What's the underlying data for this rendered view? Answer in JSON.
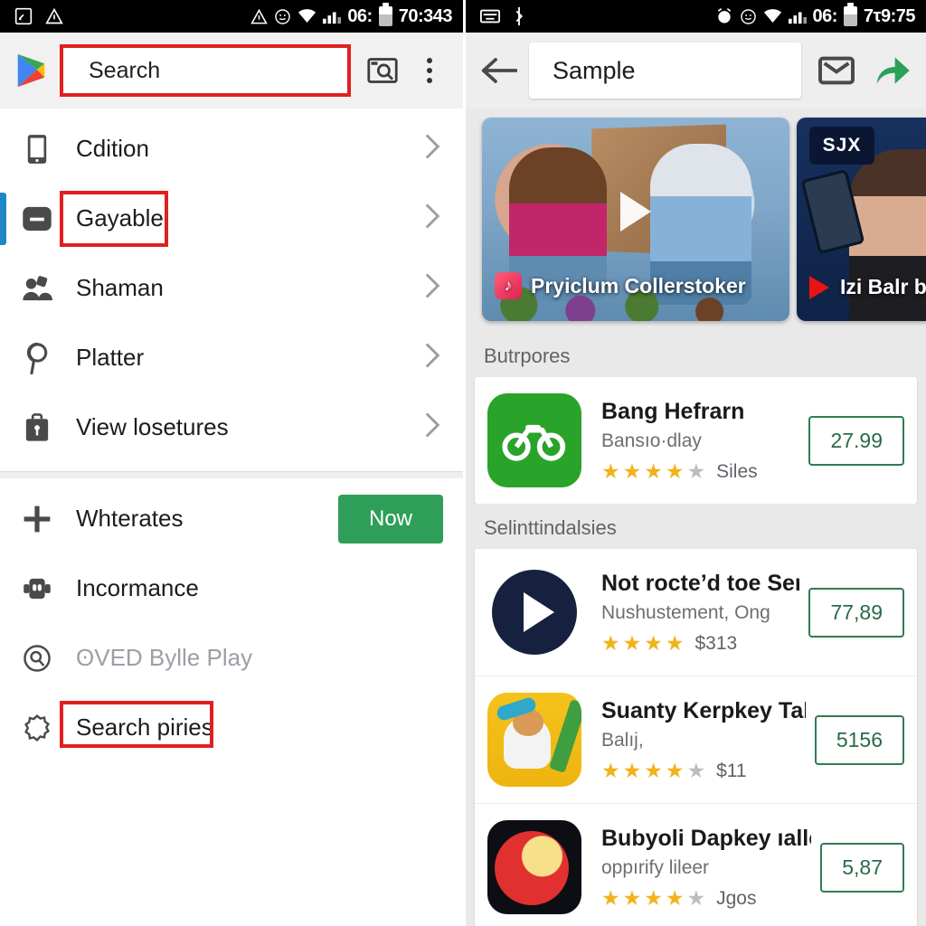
{
  "left": {
    "statusbar": {
      "icons": [
        "screenshot-icon",
        "warning-triangle-icon"
      ],
      "right_icons": [
        "warning-icon",
        "emoji-icon",
        "wifi-icon",
        "signal-icon"
      ],
      "clock": "06:",
      "extra": "70:343"
    },
    "toolbar": {
      "logo": "google-play-logo",
      "search_value": "Search",
      "voice_icon": "image-search-icon",
      "overflow_icon": "more-vertical-icon"
    },
    "menu_primary": [
      {
        "icon": "phone-icon",
        "label": "Cdition",
        "chevron": "›"
      },
      {
        "icon": "minus-box-icon",
        "label": "Gayable",
        "chevron": "›",
        "highlighted": true,
        "accent": true
      },
      {
        "icon": "people-icon",
        "label": "Shaman",
        "chevron": "›"
      },
      {
        "icon": "pinterest-p-icon",
        "label": "Platter",
        "chevron": "›"
      },
      {
        "icon": "briefcase-lock-icon",
        "label": "View losetures",
        "chevron": "›"
      }
    ],
    "menu_secondary": [
      {
        "icon": "plus-icon",
        "label": "Whterates",
        "button": "Now"
      },
      {
        "icon": "robot-icon",
        "label": "Incormance"
      },
      {
        "icon": "search-circle-icon",
        "label": "ʘVED Bylle Play",
        "muted": true
      },
      {
        "icon": "gear-outline-icon",
        "label": "Search piries",
        "highlighted": true
      }
    ],
    "colors": {
      "accent_blue": "#1e88c7",
      "highlight_red": "#e02020",
      "now_green": "#2e9e58"
    }
  },
  "right": {
    "statusbar": {
      "icons": [
        "keyboard-icon",
        "bluetooth-icon"
      ],
      "right_icons": [
        "alarm-icon",
        "emoji-icon",
        "wifi-icon",
        "signal-icon"
      ],
      "clock": "06:",
      "extra": "7τ9:75"
    },
    "toolbar": {
      "back_icon": "arrow-left-icon",
      "title_value": "Sample",
      "mail_icon": "mail-icon",
      "share_icon": "share-arrow-icon"
    },
    "carousel": [
      {
        "caption": "Pryiclum Collerstoker",
        "badge": "tiktok-badge-icon",
        "play": "play-overlay-icon"
      },
      {
        "caption": "Izi Balr b",
        "badge": "youtube-play-icon",
        "logo": "SJX"
      }
    ],
    "sections": [
      {
        "title": "Butrpores",
        "apps": [
          {
            "icon": "bike-app-icon",
            "name": "Bang Hefrarn",
            "subtitle": "Bansıo·dlay",
            "stars": 4,
            "rating_text": "Siles",
            "price": "27.99"
          }
        ]
      },
      {
        "title": "Selinttindalsies",
        "apps": [
          {
            "icon": "play-app-icon",
            "name": "Not rocte’d toe Serrent",
            "subtitle": "Nushustement, Ong",
            "stars": 4,
            "rating_text": "$313",
            "price": "77,89"
          },
          {
            "icon": "dog-app-icon",
            "name": "Suanty Κerpkey Talker",
            "subtitle": "Balıj,",
            "stars": 4,
            "rating_text": "$11",
            "price": "5156"
          },
          {
            "icon": "ball-app-icon",
            "name": "Bubyoli Dapkey ıaller",
            "subtitle": "oppırify lileer",
            "stars": 4,
            "rating_text": "Jgos",
            "price": "5,87"
          }
        ]
      }
    ],
    "colors": {
      "price_border": "#2e7d52",
      "star_gold": "#f2b21b",
      "share_green": "#2aa05a"
    }
  }
}
